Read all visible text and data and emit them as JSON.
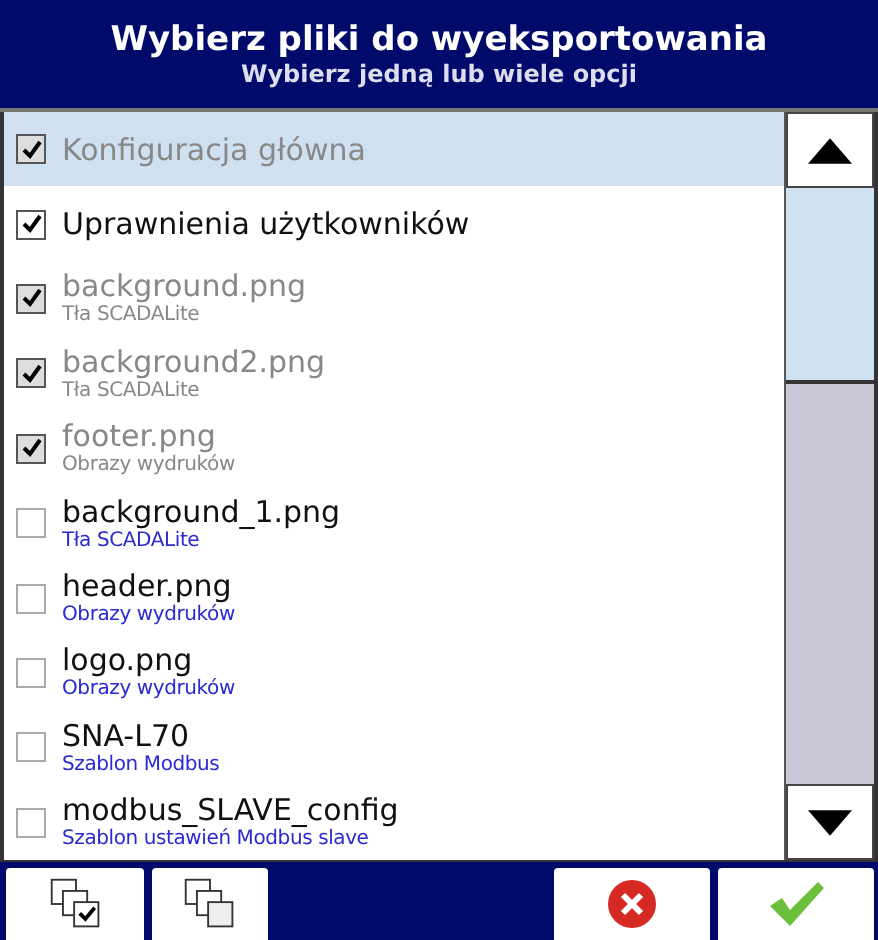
{
  "header": {
    "title": "Wybierz pliki do wyeksportowania",
    "subtitle": "Wybierz jedną lub wiele opcji"
  },
  "items": [
    {
      "label": "Konfiguracja główna",
      "checked": true,
      "disabled": true,
      "selected": true
    },
    {
      "label": "Uprawnienia użytkowników",
      "checked": true,
      "disabled": false,
      "selected": false
    },
    {
      "label": "background.png",
      "sublabel": "Tła SCADALite",
      "checked": true,
      "disabled": true,
      "selected": false
    },
    {
      "label": "background2.png",
      "sublabel": "Tła SCADALite",
      "checked": true,
      "disabled": true,
      "selected": false
    },
    {
      "label": "footer.png",
      "sublabel": "Obrazy wydruków",
      "checked": true,
      "disabled": true,
      "selected": false
    },
    {
      "label": "background_1.png",
      "sublabel": "Tła SCADALite",
      "checked": false,
      "disabled": false,
      "selected": false
    },
    {
      "label": "header.png",
      "sublabel": "Obrazy wydruków",
      "checked": false,
      "disabled": false,
      "selected": false
    },
    {
      "label": "logo.png",
      "sublabel": "Obrazy wydruków",
      "checked": false,
      "disabled": false,
      "selected": false
    },
    {
      "label": "SNA-L70",
      "sublabel": "Szablon Modbus",
      "checked": false,
      "disabled": false,
      "selected": false
    },
    {
      "label": "modbus_SLAVE_config",
      "sublabel": "Szablon ustawień Modbus slave",
      "checked": false,
      "disabled": false,
      "selected": false
    }
  ]
}
